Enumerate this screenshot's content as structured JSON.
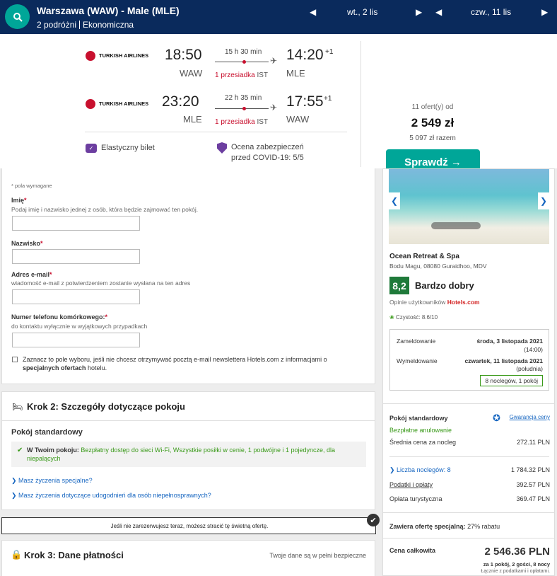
{
  "search": {
    "route": "Warszawa (WAW) - Male (MLE)",
    "travellers": "2 podróżni",
    "cabin": "Ekonomiczna",
    "depart_date": "wt., 2 lis",
    "return_date": "czw., 11 lis",
    "prev_arrow": "◀",
    "next_arrow": "▶"
  },
  "flights": [
    {
      "airline": "TURKISH AIRLINES",
      "dep_time": "18:50",
      "dep_ap": "WAW",
      "duration": "15 h 30 min",
      "arr_time": "14:20",
      "plus": "+1",
      "arr_ap": "MLE",
      "stops": "1 przesiadka",
      "via": "IST"
    },
    {
      "airline": "TURKISH AIRLINES",
      "dep_time": "23:20",
      "dep_ap": "MLE",
      "duration": "22 h 35 min",
      "arr_time": "17:55",
      "plus": "+1",
      "arr_ap": "WAW",
      "stops": "1 przesiadka",
      "via": "IST"
    }
  ],
  "flex": "Elastyczny bilet",
  "covid_line1": "Ocena zabezpieczeń",
  "covid_line2": "przed COVID-19: 5/5",
  "offers_count": "11 ofert(y) od",
  "price": "2 549 zł",
  "total": "5 097 zł razem",
  "cta": "Sprawdź →",
  "form": {
    "required_note": "* pola wymagane",
    "name_label": "Imię",
    "name_hint": "Podaj imię i nazwisko jednej z osób, która będzie zajmować ten pokój.",
    "surname_label": "Nazwisko",
    "email_label": "Adres e-mail",
    "email_hint": "wiadomość e-mail z potwierdzeniem zostanie wysłana na ten adres",
    "phone_label": "Numer telefonu komórkowego:",
    "phone_hint": "do kontaktu wyłącznie w wyjątkowych przypadkach",
    "newsletter_a": "Zaznacz to pole wyboru, jeśli nie chcesz otrzymywać pocztą e-mail newslettera Hotels.com z informacjami o",
    "newsletter_b": "specjalnych ofertach",
    "newsletter_c": " hotelu.",
    "asterisk": "*"
  },
  "step2": {
    "title": "Krok 2: Szczegóły dotyczące pokoju",
    "room": "Pokój standardowy",
    "in_room_label": "W Twoim pokoju:",
    "in_room_text": "Bezpłatny dostęp do sieci Wi-Fi, Wszystkie posiłki w cenie, 1 podwójne i 1 pojedyncze, dla niepalących",
    "wish1": "Masz życzenia specjalne?",
    "wish2": "Masz życzenia dotyczące udogodnień dla osób niepełnosprawnych?"
  },
  "warning": "Jeśli nie zarezerwujesz teraz, możesz stracić tę świetną ofertę.",
  "step3": {
    "title": "Krok 3: Dane płatności",
    "secure": "Twoje dane są w pełni bezpieczne"
  },
  "hotel": {
    "name": "Ocean Retreat & Spa",
    "address": "Bodu Magu, 08080 Guraidhoo, MDV",
    "score": "8,2",
    "score_label": "Bardzo dobry",
    "reviews": "Opinie użytkowników",
    "hotels_brand": "Hotels.com",
    "clean": "Czystość: 8.6/10",
    "checkin_label": "Zameldowanie",
    "checkin_date": "środa, 3 listopada 2021",
    "checkin_time": "(14:00)",
    "checkout_label": "Wymeldowanie",
    "checkout_date": "czwartek, 11 listopada 2021",
    "checkout_time": "(południa)",
    "nights": "8 noclegów, 1 pokój",
    "room": "Pokój standardowy",
    "guarantee": "Gwarancja ceny",
    "free_cancel": "Bezpłatne anulowanie",
    "avg_label": "Średnia cena za nocleg",
    "avg": "272.11 PLN",
    "nights_label": "Liczba noclegów: 8",
    "nights_price": "1 784.32 PLN",
    "tax_label": "Podatki i opłaty",
    "tax": "392.57 PLN",
    "tourist_label": "Opłata turystyczna",
    "tourist": "369.47 PLN",
    "special_label": "Zawiera ofertę specjalną:",
    "special": "27% rabatu",
    "total_label": "Cena całkowita",
    "total": "2 546.36 PLN",
    "total_sub": "za 1 pokój, 2 gości, 8 nocy",
    "total_sub2": "Łącznie z podatkami i opłatami."
  }
}
